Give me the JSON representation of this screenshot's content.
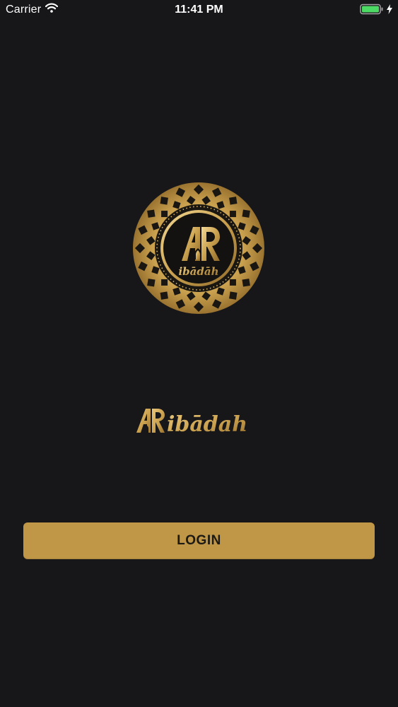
{
  "status_bar": {
    "carrier": "Carrier",
    "time": "11:41 PM",
    "icons": [
      "wifi-icon",
      "battery-icon",
      "charging-bolt-icon"
    ],
    "battery_color": "#4cd964"
  },
  "branding": {
    "emblem_monogram": "AR",
    "emblem_text": "ibadah",
    "wordmark": "Aribadah",
    "gold_color": "#c9a04e"
  },
  "login": {
    "label": "LOGIN",
    "button_color": "#c09647"
  },
  "colors": {
    "background": "#17171a"
  }
}
